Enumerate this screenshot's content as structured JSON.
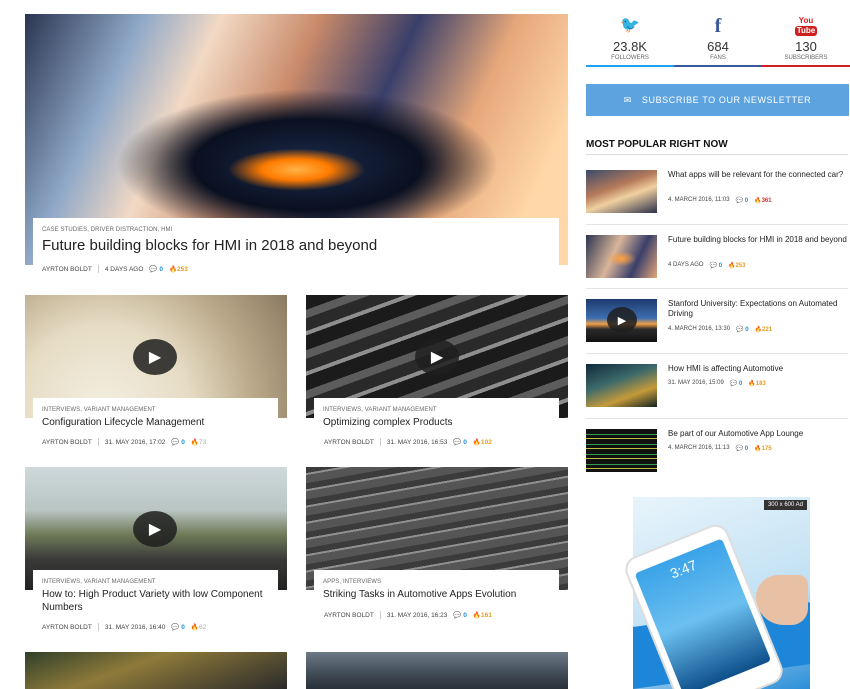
{
  "featured": {
    "categories": "CASE STUDIES, DRIVER DISTRACTION, HMI",
    "title": "Future building blocks for HMI in 2018 and beyond",
    "author": "AYRTON BOLDT",
    "date": "4 DAYS AGO",
    "comments": "0",
    "views": "253"
  },
  "cards": [
    {
      "categories": "INTERVIEWS, VARIANT MANAGEMENT",
      "title": "Configuration Lifecycle Management",
      "author": "AYRTON BOLDT",
      "date": "31. MAY 2016, 17:02",
      "comments": "0",
      "views": "73"
    },
    {
      "categories": "INTERVIEWS, VARIANT MANAGEMENT",
      "title": "Optimizing complex Products",
      "author": "AYRTON BOLDT",
      "date": "31. MAY 2016, 16:53",
      "comments": "0",
      "views": "102"
    },
    {
      "categories": "INTERVIEWS, VARIANT MANAGEMENT",
      "title": "How to: High Product Variety with low Component Numbers",
      "author": "AYRTON BOLDT",
      "date": "31. MAY 2016, 16:40",
      "comments": "0",
      "views": "62"
    },
    {
      "categories": "APPS, INTERVIEWS",
      "title": "Striking Tasks in Automotive Apps Evolution",
      "author": "AYRTON BOLDT",
      "date": "31. MAY 2016, 16:23",
      "comments": "0",
      "views": "161"
    }
  ],
  "social": [
    {
      "icon": "twitter-icon",
      "glyph": "🐦",
      "count": "23.8K",
      "label": "FOLLOWERS",
      "color": "#1da1f2"
    },
    {
      "icon": "facebook-icon",
      "glyph": "f",
      "count": "684",
      "label": "FANS",
      "color": "#3b5998"
    },
    {
      "icon": "youtube-icon",
      "glyph": "You Tube",
      "count": "130",
      "label": "SUBSCRIBERS",
      "color": "#cd201f"
    }
  ],
  "newsletter": {
    "icon": "envelope-icon",
    "label": "SUBSCRIBE TO OUR NEWSLETTER"
  },
  "popular": {
    "heading": "MOST POPULAR RIGHT NOW",
    "items": [
      {
        "title": "What apps will be relevant for the connected car?",
        "date": "4. MARCH 2016, 11:03",
        "comments": "0",
        "views": "361"
      },
      {
        "title": "Future building blocks for HMI in 2018 and beyond",
        "date": "4 DAYS AGO",
        "comments": "0",
        "views": "253"
      },
      {
        "title": "Stanford University: Expectations on Automated Driving",
        "date": "4. MARCH 2016, 13:30",
        "comments": "0",
        "views": "221"
      },
      {
        "title": "How HMI is affecting Automotive",
        "date": "31. MAY 2016, 15:09",
        "comments": "0",
        "views": "183"
      },
      {
        "title": "Be part of our Automotive App Lounge",
        "date": "4. MARCH 2016, 11:13",
        "comments": "0",
        "views": "175"
      }
    ]
  },
  "ad": {
    "tag": "300 x 600 Ad",
    "phone_time": "3:47"
  },
  "colors": {
    "accent": "#1a8fd6",
    "hot": "#e89a1a",
    "hot_red": "#d0302a",
    "newsletter": "#5ca3e0"
  }
}
